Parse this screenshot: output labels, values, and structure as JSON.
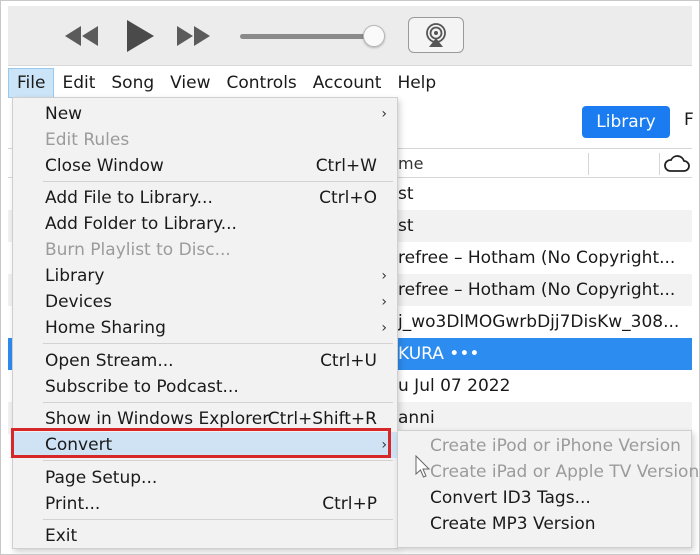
{
  "menubar": {
    "items": [
      "File",
      "Edit",
      "Song",
      "View",
      "Controls",
      "Account",
      "Help"
    ]
  },
  "library_button": "Library",
  "library_next_tab_cut": "F",
  "list": {
    "header_name": "me",
    "rows": [
      "st",
      "st",
      "refree – Hotham (No Copyright...",
      "refree – Hotham (No Copyright...",
      "j_wo3DlMOGwrbDjj7DisKw_308...",
      "KURA •••",
      "u Jul 07 2022",
      "anni"
    ],
    "selected_index": 5
  },
  "file_menu": {
    "new": "New",
    "edit_rules": "Edit Rules",
    "close_window": "Close Window",
    "close_window_shortcut": "Ctrl+W",
    "add_file": "Add File to Library...",
    "add_file_shortcut": "Ctrl+O",
    "add_folder": "Add Folder to Library...",
    "burn_playlist": "Burn Playlist to Disc...",
    "library": "Library",
    "devices": "Devices",
    "home_sharing": "Home Sharing",
    "open_stream": "Open Stream...",
    "open_stream_shortcut": "Ctrl+U",
    "subscribe_podcast": "Subscribe to Podcast...",
    "show_explorer": "Show in Windows Explorer",
    "show_explorer_shortcut": "Ctrl+Shift+R",
    "convert": "Convert",
    "page_setup": "Page Setup...",
    "print": "Print...",
    "print_shortcut": "Ctrl+P",
    "exit": "Exit",
    "submenu_arrow": "›"
  },
  "convert_submenu": {
    "ipod_iphone": "Create iPod or iPhone Version",
    "ipad_appletv": "Create iPad or Apple TV Version",
    "convert_id3": "Convert ID3 Tags...",
    "create_mp3": "Create MP3 Version"
  },
  "colors": {
    "accent": "#1a7cf0",
    "selection": "#2d8cf0",
    "highlight_border": "#d62828"
  }
}
